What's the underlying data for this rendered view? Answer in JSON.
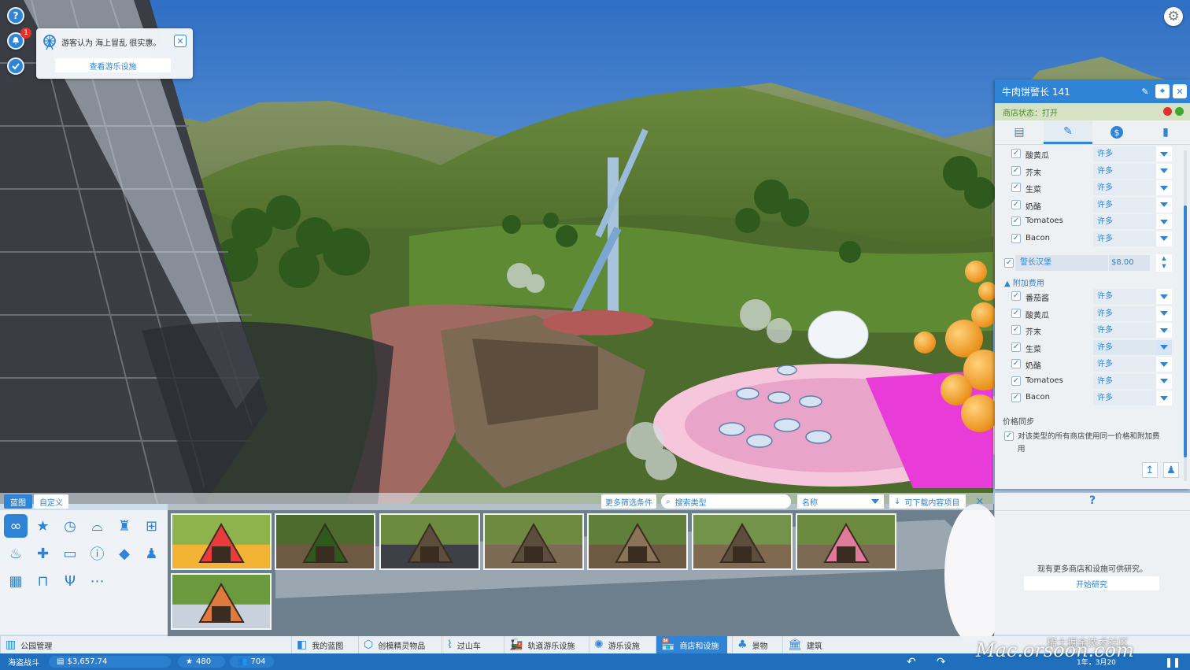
{
  "topleft": {
    "help_icon": "?",
    "notification_count": "1"
  },
  "notification": {
    "text": "游客认为 海上冒乱 很实惠。",
    "link": "查看游乐设施",
    "icon": "ferris-wheel-icon"
  },
  "shop_panel": {
    "title": "牛肉饼警长 141",
    "status": "商店状态：打开",
    "tabs": [
      "clipboard-icon",
      "tag-icon",
      "dollar-icon",
      "chart-icon"
    ],
    "ingredients": [
      {
        "name": "酸黄瓜",
        "value": "许多"
      },
      {
        "name": "芥末",
        "value": "许多"
      },
      {
        "name": "生菜",
        "value": "许多"
      },
      {
        "name": "奶酪",
        "value": "许多"
      },
      {
        "name": "Tomatoes",
        "value": "许多"
      },
      {
        "name": "Bacon",
        "value": "许多"
      }
    ],
    "main_item": {
      "name": "警长汉堡",
      "price": "$8.00"
    },
    "extras_label": "附加费用",
    "extras": [
      {
        "name": "番茄酱",
        "value": "许多"
      },
      {
        "name": "酸黄瓜",
        "value": "许多"
      },
      {
        "name": "芥末",
        "value": "许多"
      },
      {
        "name": "生菜",
        "value": "许多"
      },
      {
        "name": "奶酪",
        "value": "许多"
      },
      {
        "name": "Tomatoes",
        "value": "许多"
      },
      {
        "name": "Bacon",
        "value": "许多"
      }
    ],
    "price_sync_title": "价格同步",
    "price_sync_text": "对该类型的所有商店使用同一价格和附加费用"
  },
  "info_panel": {
    "help": "?",
    "message": "现有更多商店和设施可供研究。",
    "research_button": "开始研究"
  },
  "build_menu": {
    "tab_blueprint": "蓝图",
    "tab_custom": "自定义",
    "more_filters": "更多筛选条件",
    "search_placeholder": "搜索类型",
    "sort_label": "名称",
    "download_label": "可下载内容项目",
    "categories": [
      "infinity-icon",
      "star-icon",
      "clock-icon",
      "hat-icon",
      "trash-icon",
      "gift-icon",
      "cup-icon",
      "firstaid-icon",
      "atm-icon",
      "info-icon",
      "ticket-icon",
      "staff-icon",
      "building-icon",
      "gate-icon",
      "food-icon",
      "more-icon"
    ]
  },
  "navbar": {
    "items": [
      "公园管理",
      "我的蓝图",
      "创模精灵物品",
      "过山车",
      "轨道游乐设施",
      "游乐设施",
      "商店和设施",
      "景物",
      "建筑"
    ]
  },
  "statusbar": {
    "park_name": "海盗战斗",
    "money": "$3,657.74",
    "rating": "480",
    "guests": "704",
    "date": "1年，3月20"
  },
  "watermark": "Mac.orsoon.com",
  "watermark_cn": "稀土掘金技术社区",
  "colors": {
    "accent": "#2f84d6",
    "status_green": "#4a8a25",
    "close_red": "#e0322d"
  }
}
